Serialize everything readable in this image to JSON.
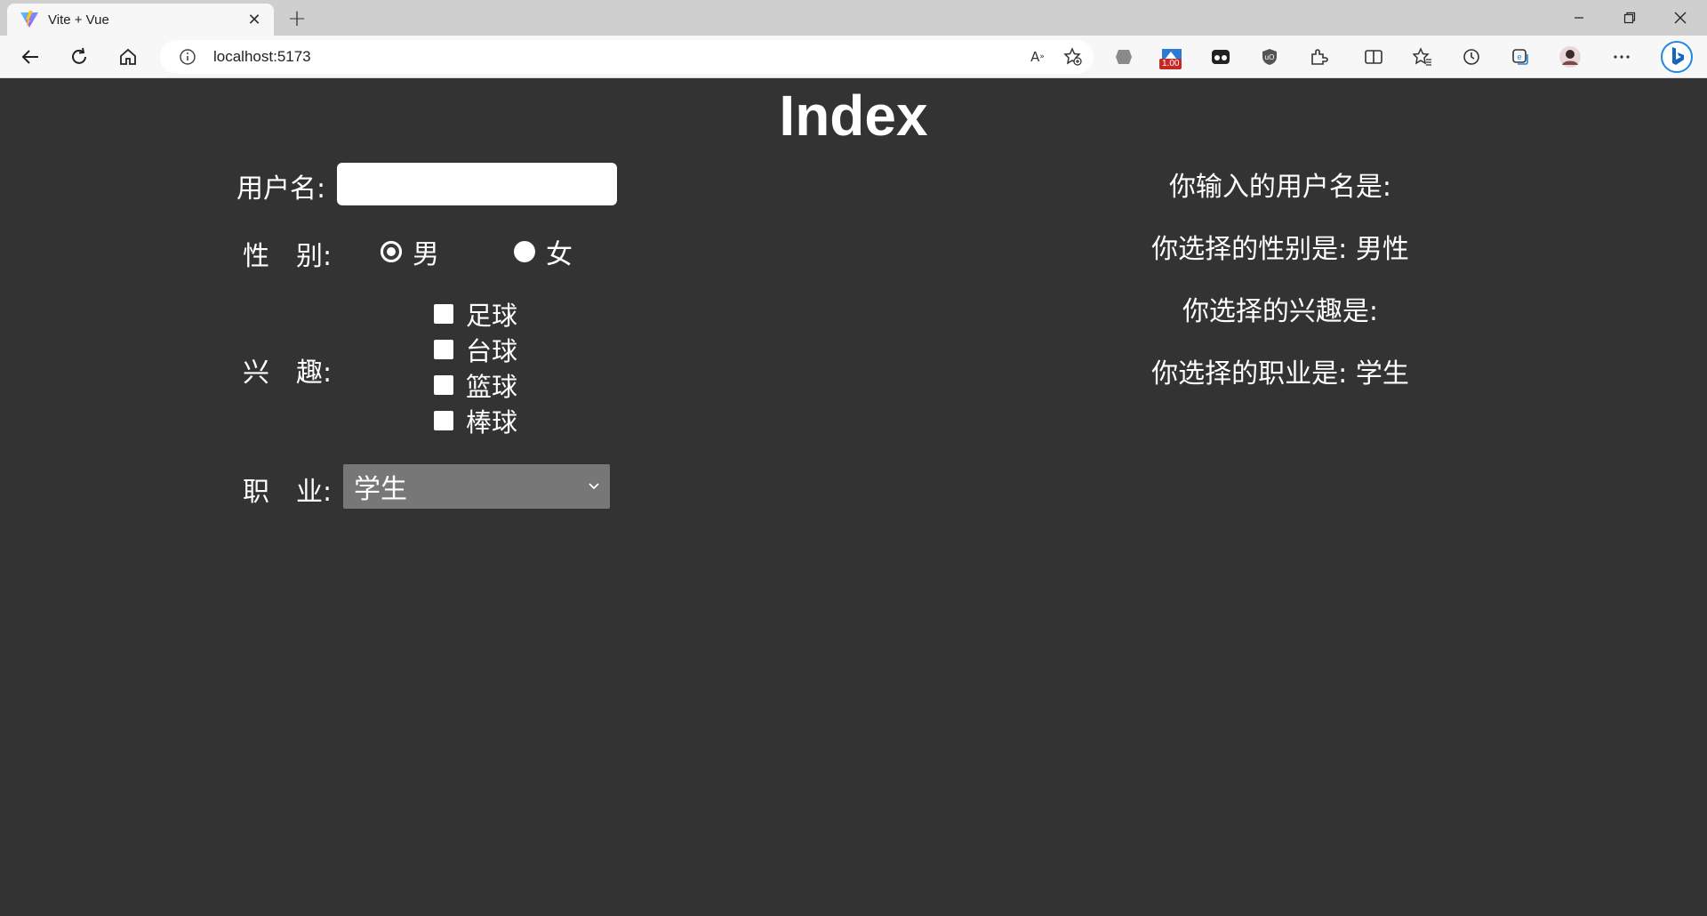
{
  "browser": {
    "tab_title": "Vite + Vue",
    "url": "localhost:5173",
    "extension_badge": "1.00"
  },
  "page": {
    "title": "Index",
    "form": {
      "username_label": "用户名:",
      "username_value": "",
      "gender_label": "性　别:",
      "gender_options": [
        "男",
        "女"
      ],
      "gender_selected": "男",
      "hobby_label": "兴　趣:",
      "hobby_options": [
        "足球",
        "台球",
        "篮球",
        "棒球"
      ],
      "job_label": "职　业:",
      "job_selected": "学生"
    },
    "results": {
      "username_line": "你输入的用户名是:",
      "gender_line": "你选择的性别是: 男性",
      "hobby_line": "你选择的兴趣是:",
      "job_line": "你选择的职业是: 学生"
    }
  }
}
